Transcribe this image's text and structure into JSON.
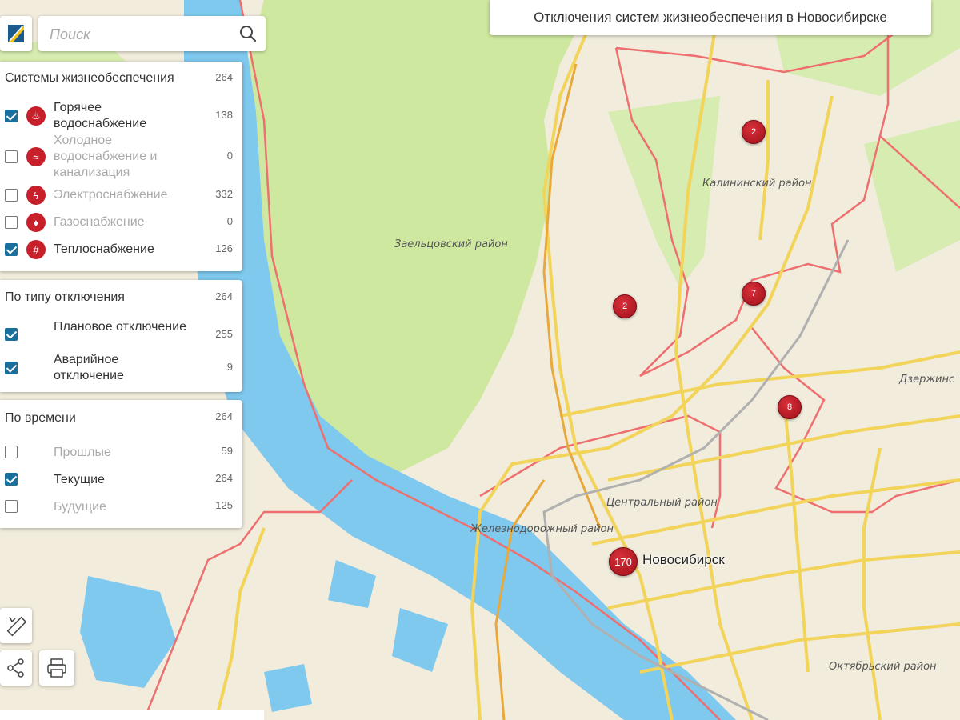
{
  "header": {
    "title": "Отключения систем жизнеобеспечения в Новосибирске"
  },
  "search": {
    "placeholder": "Поиск",
    "value": ""
  },
  "icons": {
    "logo": "city-logo-icon",
    "search": "search-icon",
    "ruler": "ruler-icon",
    "share": "share-icon",
    "print": "printer-icon"
  },
  "colors": {
    "accent": "#1a6f9c",
    "marker": "#c8202a",
    "park": "#cfe8a0",
    "water": "#7fc8ee",
    "district_border": "#ee6f6f",
    "road": "#f2d45a"
  },
  "panels": [
    {
      "title": "Системы жизнеобеспечения",
      "count": "264",
      "items": [
        {
          "label": "Горячее водоснабжение",
          "count": "138",
          "checked": true,
          "icon": "hot-water-icon"
        },
        {
          "label": "Холодное водоснабжение и канализация",
          "count": "0",
          "checked": false,
          "icon": "cold-water-icon"
        },
        {
          "label": "Электроснабжение",
          "count": "332",
          "checked": false,
          "icon": "electricity-icon"
        },
        {
          "label": "Газоснабжение",
          "count": "0",
          "checked": false,
          "icon": "gas-icon"
        },
        {
          "label": "Теплоснабжение",
          "count": "126",
          "checked": true,
          "icon": "heating-icon"
        }
      ]
    },
    {
      "title": "По типу отключения",
      "count": "264",
      "items": [
        {
          "label": "Плановое отключение",
          "count": "255",
          "checked": true
        },
        {
          "label": "Аварийное отключение",
          "count": "9",
          "checked": true
        }
      ]
    },
    {
      "title": "По времени",
      "count": "264",
      "items": [
        {
          "label": "Прошлые",
          "count": "59",
          "checked": false
        },
        {
          "label": "Текущие",
          "count": "264",
          "checked": true
        },
        {
          "label": "Будущие",
          "count": "125",
          "checked": false
        }
      ]
    }
  ],
  "map": {
    "districts": [
      "Калининский район",
      "Заельцовский район",
      "Дзержинс",
      "Центральный район",
      "Железнодорожный район",
      "Октябрьский район"
    ],
    "city": "Новосибирск",
    "markers": [
      "2",
      "2",
      "7",
      "8",
      "170"
    ]
  }
}
